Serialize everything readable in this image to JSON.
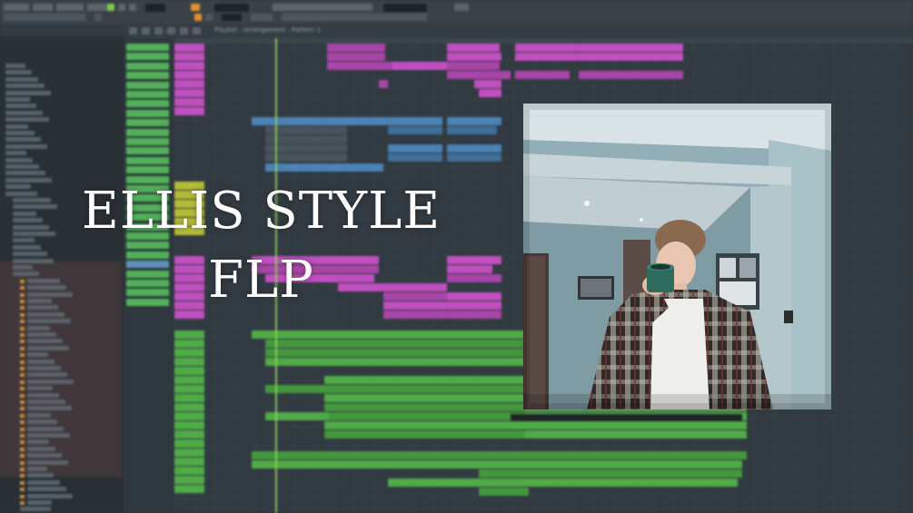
{
  "app": {
    "playlist_title": "Playlist - Arrangement - Pattern 1"
  },
  "overlay": {
    "title_line1": "ELLIS STYLE",
    "title_line2": "FLP"
  },
  "photo": {
    "subject": "person-drinking-from-mug"
  },
  "colors": {
    "accent_green": "#7bc74a",
    "clip_pink": "#c04fbf",
    "clip_blue": "#4a82b4",
    "clip_green": "#4faa47",
    "orange": "#e0902e"
  }
}
